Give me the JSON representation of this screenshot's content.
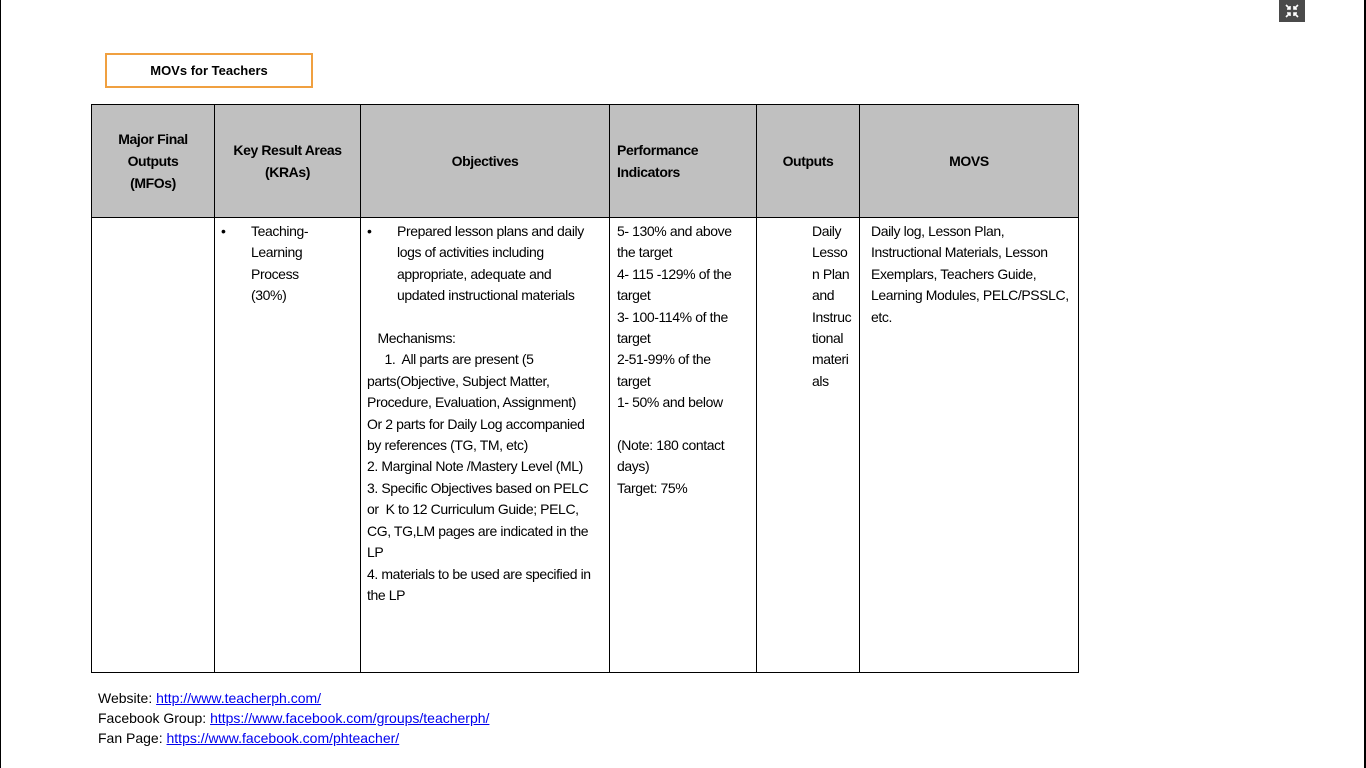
{
  "fullscreen_icon": "exit-fullscreen-icon",
  "title": "MOVs for Teachers",
  "headers": {
    "mfo": [
      "Major Final",
      "Outputs",
      "(MFOs)"
    ],
    "kra": [
      "Key Result Areas",
      "(KRAs)"
    ],
    "objectives": "Objectives",
    "indicators": [
      "Performance",
      "Indicators"
    ],
    "outputs": "Outputs",
    "movs": "MOVS"
  },
  "row": {
    "kra": [
      "Teaching-",
      "Learning",
      "Process",
      "(30%)"
    ],
    "objective_bullet": [
      "Prepared lesson plans and daily",
      "logs of activities including",
      "appropriate, adequate and",
      "updated instructional materials"
    ],
    "mechanisms": [
      "",
      "   Mechanisms:",
      "     1.  All parts are present (5",
      "parts(Objective, Subject Matter,",
      "Procedure, Evaluation, Assignment)",
      "Or 2 parts for Daily Log accompanied",
      "by references (TG, TM, etc)",
      "2. Marginal Note /Mastery Level (ML)",
      "3. Specific Objectives based on PELC",
      "or  K to 12 Curriculum Guide; PELC,",
      "CG, TG,LM pages are indicated in the",
      "LP",
      "4. materials to be used are specified in",
      "the LP"
    ],
    "indicators": [
      "5- 130% and above",
      "the target",
      "4- 115 -129% of the",
      "target",
      "3- 100-114% of the",
      "target",
      "2-51-99% of the",
      "target",
      "1- 50% and below",
      "",
      "(Note: 180 contact",
      "days)",
      "Target: 75%"
    ],
    "outputs": [
      "Daily",
      "Lesso",
      "n Plan",
      "and",
      "Instruc",
      "tional",
      "materi",
      "als"
    ],
    "movs": [
      "Daily log, Lesson Plan,",
      "Instructional Materials, Lesson",
      "Exemplars, Teachers Guide,",
      "Learning Modules, PELC/PSSLC,",
      "etc."
    ]
  },
  "footer": {
    "website_label": "Website: ",
    "website_link": "http://www.teacherph.com/",
    "fb_label": "Facebook Group: ",
    "fb_link": "https://www.facebook.com/groups/teacherph/",
    "fan_label": "Fan Page: ",
    "fan_link": "https://www.facebook.com/phteacher/"
  }
}
